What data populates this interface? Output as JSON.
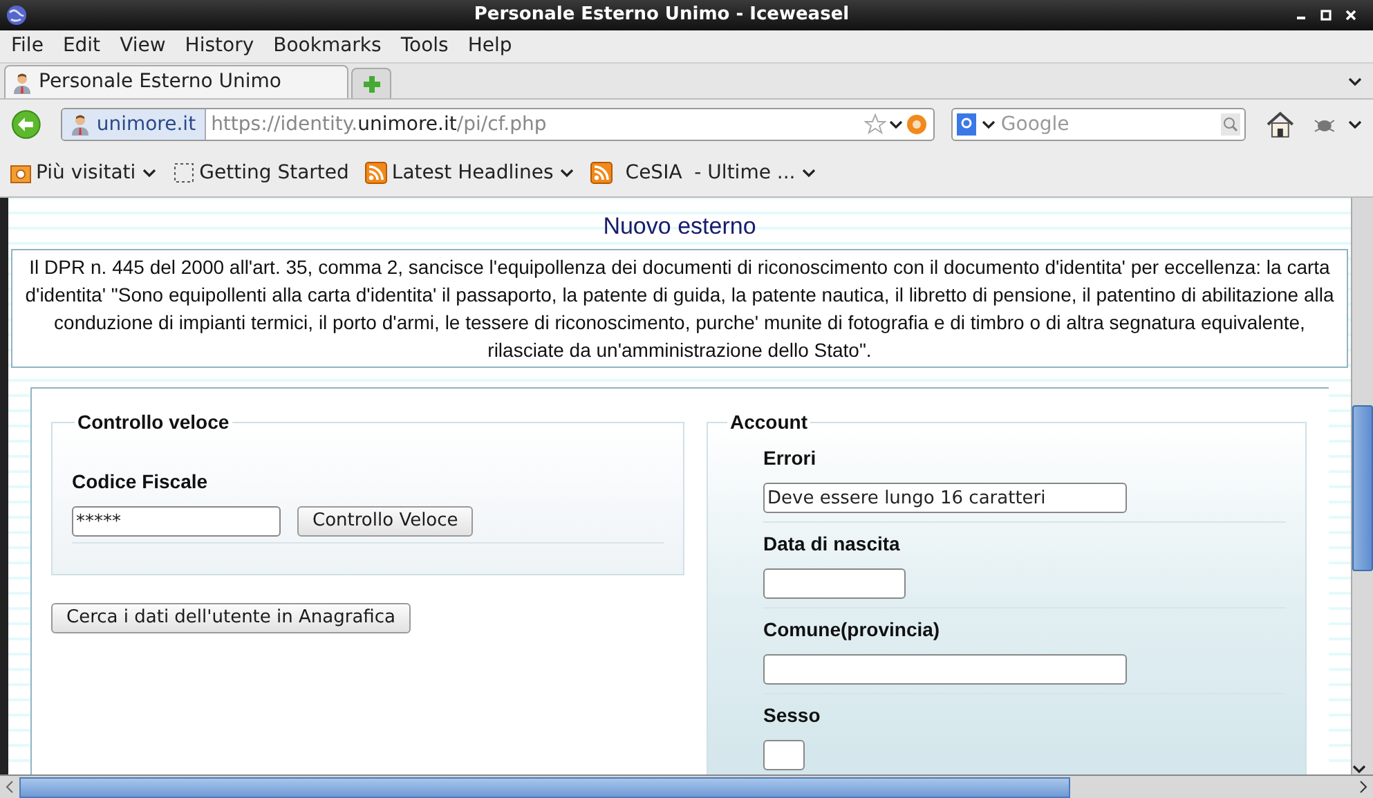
{
  "window": {
    "title": "Personale Esterno Unimo - Iceweasel"
  },
  "menu": [
    {
      "label": "File"
    },
    {
      "label": "Edit"
    },
    {
      "label": "View"
    },
    {
      "label": "History"
    },
    {
      "label": "Bookmarks"
    },
    {
      "label": "Tools"
    },
    {
      "label": "Help"
    }
  ],
  "tabs": [
    {
      "label": "Personale Esterno Unimo",
      "selected": true
    }
  ],
  "address": {
    "identity": "unimore.it",
    "url_prefix": "https://identity.",
    "url_domain": "unimore.it",
    "url_path": "/pi/cf.php"
  },
  "search": {
    "placeholder": "Google"
  },
  "bookmarks": [
    {
      "label": "Più visitati",
      "kind": "folder",
      "menu": true
    },
    {
      "label": "Getting Started",
      "kind": "page",
      "menu": false
    },
    {
      "label": "Latest Headlines",
      "kind": "feed",
      "menu": true
    },
    {
      "label": "CeSIA  - Ultime ...",
      "kind": "feed",
      "menu": true
    }
  ],
  "page": {
    "heading": "Nuovo esterno",
    "notice": "Il DPR n. 445 del 2000 all'art. 35, comma 2, sancisce l'equipollenza dei documenti di riconoscimento con il documento d'identita' per eccellenza: la carta d'identita' \"Sono equipollenti alla carta d'identita' il passaporto, la patente di guida, la patente nautica, il libretto di pensione, il patentino di abilitazione alla conduzione di impianti termici, il porto d'armi, le tessere di riconoscimento, purche' munite di fotografia e di timbro o di altra segnatura equivalente, rilasciate da un'amministrazione dello Stato\".",
    "quick_check": {
      "legend": "Controllo veloce",
      "field_label": "Codice Fiscale",
      "value": "*****",
      "button": "Controllo Veloce"
    },
    "lookup_button": "Cerca i dati dell'utente in Anagrafica",
    "account": {
      "legend": "Account",
      "fields": [
        {
          "label": "Errori",
          "value": "Deve essere lungo 16 caratteri",
          "kind": "wide"
        },
        {
          "label": "Data di nascita",
          "kind": "short"
        },
        {
          "label": "Comune(provincia)",
          "kind": "wide"
        },
        {
          "label": "Sesso",
          "kind": "tiny"
        }
      ]
    }
  }
}
